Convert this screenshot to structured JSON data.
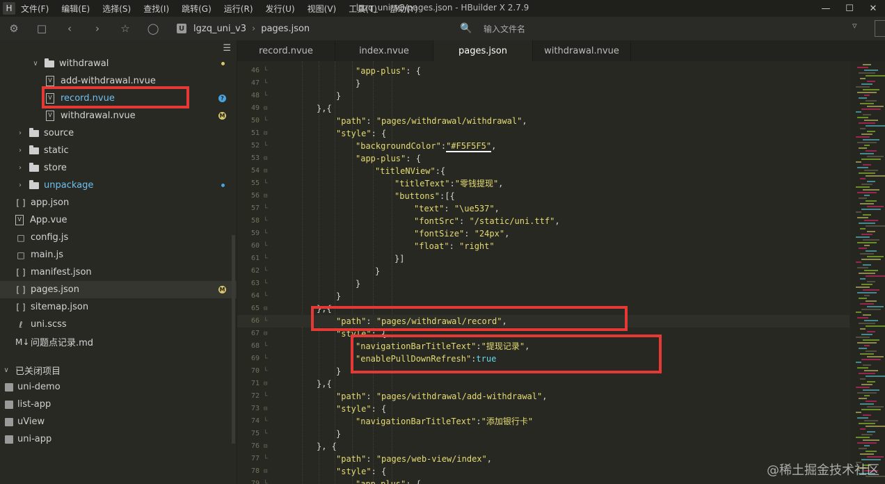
{
  "app": {
    "logo": "H",
    "window_title": "lgzq_uni_v3/pages.json - HBuilder X 2.7.9",
    "menu": [
      "文件(F)",
      "编辑(E)",
      "选择(S)",
      "查找(I)",
      "跳转(G)",
      "运行(R)",
      "发行(U)",
      "视图(V)",
      "工具(T)",
      "帮助(Y)"
    ],
    "window_controls": {
      "minimize": "—",
      "maximize": "☐",
      "close": "✕"
    }
  },
  "toolbar": {
    "breadcrumb": {
      "project_icon": "U",
      "project": "lgzq_uni_v3",
      "file": "pages.json"
    },
    "search_placeholder": "输入文件名"
  },
  "sidebar": {
    "tree": [
      {
        "label": "withdrawal",
        "kind": "folder",
        "expanded": true,
        "marker": "dot",
        "marker_color": "#d8c86a"
      },
      {
        "label": "add-withdrawal.nvue",
        "kind": "file"
      },
      {
        "label": "record.nvue",
        "kind": "file",
        "marker": "?",
        "marker_color": "#4aa3df",
        "highlight": true
      },
      {
        "label": "withdrawal.nvue",
        "kind": "file",
        "marker": "M",
        "marker_color": "#d8c86a"
      },
      {
        "label": "source",
        "kind": "folder",
        "expanded": false
      },
      {
        "label": "static",
        "kind": "folder",
        "expanded": false
      },
      {
        "label": "store",
        "kind": "folder",
        "expanded": false
      },
      {
        "label": "unpackage",
        "kind": "folder",
        "expanded": false,
        "marker": "dot",
        "marker_color": "#4aa3df",
        "highlight": true
      },
      {
        "label": "app.json",
        "kind": "json",
        "icon": "[ ]"
      },
      {
        "label": "App.vue",
        "kind": "vue",
        "icon": "V"
      },
      {
        "label": "config.js",
        "kind": "js"
      },
      {
        "label": "main.js",
        "kind": "js"
      },
      {
        "label": "manifest.json",
        "kind": "json",
        "icon": "[ ]"
      },
      {
        "label": "pages.json",
        "kind": "json",
        "icon": "[ ]",
        "marker": "M",
        "marker_color": "#d8c86a",
        "selected": true
      },
      {
        "label": "sitemap.json",
        "kind": "json",
        "icon": "[ ]"
      },
      {
        "label": "uni.scss",
        "kind": "scss",
        "icon": "ℓ"
      },
      {
        "label": "问题点记录.md",
        "kind": "md",
        "icon": "M↓"
      }
    ],
    "closed_projects_header": "已关闭项目",
    "closed_projects": [
      "uni-demo",
      "list-app",
      "uView",
      "uni-app"
    ]
  },
  "tabs": [
    {
      "label": "record.nvue"
    },
    {
      "label": "index.nvue"
    },
    {
      "label": "pages.json",
      "active": true
    },
    {
      "label": "withdrawal.nvue"
    }
  ],
  "editor": {
    "lines": [
      {
        "n": "46",
        "indent": 4,
        "parts": [
          [
            "s",
            "\"app-plus\""
          ],
          [
            "p",
            ": {"
          ]
        ]
      },
      {
        "n": "47",
        "indent": 4,
        "parts": [
          [
            "p",
            "}"
          ]
        ]
      },
      {
        "n": "48",
        "indent": 3,
        "parts": [
          [
            "p",
            "}"
          ]
        ]
      },
      {
        "n": "49",
        "indent": 2,
        "parts": [
          [
            "p",
            "},{"
          ]
        ]
      },
      {
        "n": "50",
        "indent": 3,
        "parts": [
          [
            "s",
            "\"path\""
          ],
          [
            "p",
            ": "
          ],
          [
            "s",
            "\"pages/withdrawal/withdrawal\""
          ],
          [
            "p",
            ","
          ]
        ]
      },
      {
        "n": "51",
        "indent": 3,
        "parts": [
          [
            "s",
            "\"style\""
          ],
          [
            "p",
            ": {"
          ]
        ]
      },
      {
        "n": "52",
        "indent": 4,
        "parts": [
          [
            "s",
            "\"backgroundColor\""
          ],
          [
            "p",
            ":"
          ],
          [
            "s",
            "\"#F5F5F5\""
          ],
          [
            "p",
            ","
          ]
        ]
      },
      {
        "n": "53",
        "indent": 4,
        "parts": [
          [
            "s",
            "\"app-plus\""
          ],
          [
            "p",
            ": {"
          ]
        ]
      },
      {
        "n": "54",
        "indent": 5,
        "parts": [
          [
            "s",
            "\"titleNView\""
          ],
          [
            "p",
            ":{"
          ]
        ]
      },
      {
        "n": "55",
        "indent": 6,
        "parts": [
          [
            "s",
            "\"titleText\""
          ],
          [
            "p",
            ":"
          ],
          [
            "s",
            "\"零钱提现\""
          ],
          [
            "p",
            ","
          ]
        ]
      },
      {
        "n": "56",
        "indent": 6,
        "parts": [
          [
            "s",
            "\"buttons\""
          ],
          [
            "p",
            ":[{"
          ]
        ]
      },
      {
        "n": "57",
        "indent": 7,
        "parts": [
          [
            "s",
            "\"text\""
          ],
          [
            "p",
            ": "
          ],
          [
            "s",
            "\"\\ue537\""
          ],
          [
            "p",
            ","
          ]
        ]
      },
      {
        "n": "58",
        "indent": 7,
        "parts": [
          [
            "s",
            "\"fontSrc\""
          ],
          [
            "p",
            ": "
          ],
          [
            "s",
            "\"/static/uni.ttf\""
          ],
          [
            "p",
            ","
          ]
        ]
      },
      {
        "n": "59",
        "indent": 7,
        "parts": [
          [
            "s",
            "\"fontSize\""
          ],
          [
            "p",
            ": "
          ],
          [
            "s",
            "\"24px\""
          ],
          [
            "p",
            ","
          ]
        ]
      },
      {
        "n": "60",
        "indent": 7,
        "parts": [
          [
            "s",
            "\"float\""
          ],
          [
            "p",
            ": "
          ],
          [
            "s",
            "\"right\""
          ]
        ]
      },
      {
        "n": "61",
        "indent": 6,
        "parts": [
          [
            "p",
            "}]"
          ]
        ]
      },
      {
        "n": "62",
        "indent": 5,
        "parts": [
          [
            "p",
            "}"
          ]
        ]
      },
      {
        "n": "63",
        "indent": 4,
        "parts": [
          [
            "p",
            "}"
          ]
        ]
      },
      {
        "n": "64",
        "indent": 3,
        "parts": [
          [
            "p",
            "}"
          ]
        ]
      },
      {
        "n": "65",
        "indent": 2,
        "parts": [
          [
            "p",
            "},{"
          ]
        ]
      },
      {
        "n": "66",
        "indent": 3,
        "parts": [
          [
            "s",
            "\"path\""
          ],
          [
            "p",
            ": "
          ],
          [
            "s",
            "\"pages/withdrawal/record\""
          ],
          [
            "p",
            ","
          ]
        ],
        "current": true
      },
      {
        "n": "67",
        "indent": 3,
        "parts": [
          [
            "s",
            "\"style\""
          ],
          [
            "p",
            ": {"
          ]
        ]
      },
      {
        "n": "68",
        "indent": 4,
        "parts": [
          [
            "s",
            "\"navigationBarTitleText\""
          ],
          [
            "p",
            ":"
          ],
          [
            "s",
            "\"提现记录\""
          ],
          [
            "p",
            ","
          ]
        ]
      },
      {
        "n": "69",
        "indent": 4,
        "parts": [
          [
            "s",
            "\"enablePullDownRefresh\""
          ],
          [
            "p",
            ":"
          ],
          [
            "b",
            "true"
          ]
        ]
      },
      {
        "n": "70",
        "indent": 3,
        "parts": [
          [
            "p",
            "}"
          ]
        ]
      },
      {
        "n": "71",
        "indent": 2,
        "parts": [
          [
            "p",
            "},{"
          ]
        ]
      },
      {
        "n": "72",
        "indent": 3,
        "parts": [
          [
            "s",
            "\"path\""
          ],
          [
            "p",
            ": "
          ],
          [
            "s",
            "\"pages/withdrawal/add-withdrawal\""
          ],
          [
            "p",
            ","
          ]
        ]
      },
      {
        "n": "73",
        "indent": 3,
        "parts": [
          [
            "s",
            "\"style\""
          ],
          [
            "p",
            ": {"
          ]
        ]
      },
      {
        "n": "74",
        "indent": 4,
        "parts": [
          [
            "s",
            "\"navigationBarTitleText\""
          ],
          [
            "p",
            ":"
          ],
          [
            "s",
            "\"添加银行卡\""
          ]
        ]
      },
      {
        "n": "75",
        "indent": 3,
        "parts": [
          [
            "p",
            "}"
          ]
        ]
      },
      {
        "n": "76",
        "indent": 2,
        "parts": [
          [
            "p",
            "}, {"
          ]
        ]
      },
      {
        "n": "77",
        "indent": 3,
        "parts": [
          [
            "s",
            "\"path\""
          ],
          [
            "p",
            ": "
          ],
          [
            "s",
            "\"pages/web-view/index\""
          ],
          [
            "p",
            ","
          ]
        ]
      },
      {
        "n": "78",
        "indent": 3,
        "parts": [
          [
            "s",
            "\"style\""
          ],
          [
            "p",
            ": {"
          ]
        ]
      },
      {
        "n": "79",
        "indent": 4,
        "parts": [
          [
            "s",
            "\"app-plus\""
          ],
          [
            "p",
            ": {"
          ]
        ]
      }
    ]
  },
  "watermark": "@稀土掘金技术社区",
  "colors": {
    "key": "#a6e22e",
    "string": "#e6db74",
    "boolean": "#66d9ef",
    "annotation": "#e53935"
  }
}
